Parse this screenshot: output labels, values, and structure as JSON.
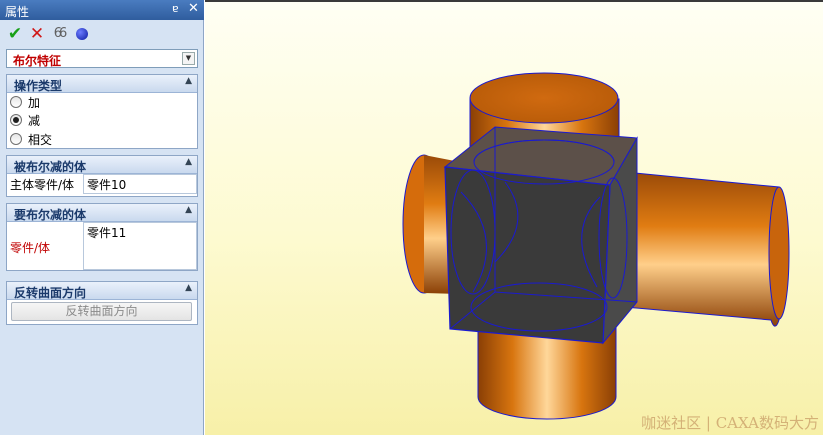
{
  "panel": {
    "title": "属性",
    "pin_glyph": "ɐ",
    "close_glyph": "✕"
  },
  "toolbar": {
    "ok_glyph": "✔",
    "cancel_glyph": "✕",
    "preview_glyph": "66",
    "icons": [
      "check-icon",
      "cross-icon",
      "glasses-icon",
      "help-dot-icon"
    ]
  },
  "feature_combo": {
    "value": "布尔特征",
    "arrow": "▼"
  },
  "operation_group": {
    "title": "操作类型",
    "options": [
      {
        "label": "加",
        "selected": false
      },
      {
        "label": "减",
        "selected": true
      },
      {
        "label": "相交",
        "selected": false
      }
    ]
  },
  "subtracted_group": {
    "title": "被布尔减的体",
    "field_label": "主体零件/体",
    "field_value": "零件10"
  },
  "tool_group": {
    "title": "要布尔减的体",
    "field_label": "零件/体",
    "field_value": "零件11"
  },
  "reverse_group": {
    "title": "反转曲面方向",
    "button_label": "反转曲面方向"
  },
  "collapse_arrow": "▲",
  "viewport": {
    "watermark": "咖迷社区 | CAXA数码大方",
    "colors": {
      "cylinder": "#c8640c",
      "box": "#3a3a3a",
      "edges": "#1a1ad0",
      "background": "#fdfad0"
    }
  }
}
